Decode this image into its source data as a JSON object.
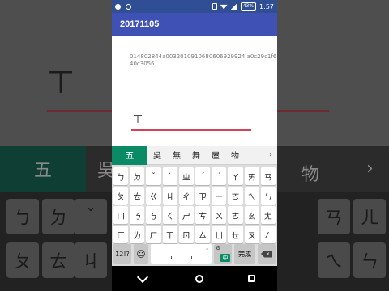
{
  "status_bar": {
    "battery": "43%",
    "time": "1:57"
  },
  "app": {
    "title": "20171105",
    "hash_text": "014802844a0032010910680606929924 a0c29c1f6104612855682408 40c3056",
    "input_value": "ㄒ"
  },
  "keyboard": {
    "selected_candidate": "五",
    "candidates": [
      "吳",
      "無",
      "舞",
      "屋",
      "物"
    ],
    "more_label": "›",
    "rows": [
      [
        "ㄅ",
        "ㄉ",
        "ˇ",
        "ˋ",
        "ㄓ",
        "ˊ",
        "˙",
        "ㄚ",
        "ㄞ",
        "ㄢ"
      ],
      [
        "ㄆ",
        "ㄊ",
        "ㄍ",
        "ㄐ",
        "ㄔ",
        "ㄗ",
        "ㄧ",
        "ㄛ",
        "ㄟ",
        "ㄣ"
      ],
      [
        "ㄇ",
        "ㄋ",
        "ㄎ",
        "ㄑ",
        "ㄕ",
        "ㄘ",
        "ㄨ",
        "ㄜ",
        "ㄠ",
        "ㄤ"
      ],
      [
        "ㄈ",
        "ㄌ",
        "ㄏ",
        "ㄒ",
        "ㄖ",
        "ㄙ",
        "ㄩ",
        "ㄝ",
        "ㄡ",
        "ㄥ"
      ]
    ],
    "symbols_label": "12!?",
    "emoji_label": "☺",
    "lang_gear": "⚙",
    "lang_badge": "中",
    "done_label": "完成",
    "delete_label": "×",
    "mic_label": "↓"
  },
  "background_copy": {
    "char": "ㄒ",
    "selected": "五",
    "cand1": "吳",
    "cand_right": "物",
    "chev": "›",
    "keys": [
      "ㄅ",
      "ㄉ",
      "ˇ",
      "ㄢ",
      "ㄦ",
      "ㄆ",
      "ㄊ",
      "ㄐ",
      "ㄟ",
      "ㄣ"
    ]
  }
}
